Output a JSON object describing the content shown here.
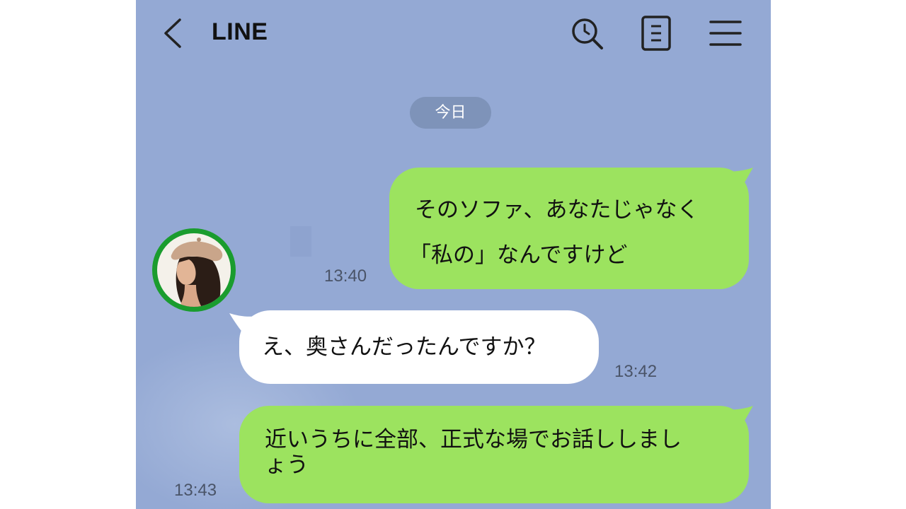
{
  "header": {
    "title": "LINE",
    "icons": [
      "back-icon",
      "search-icon",
      "notes-icon",
      "menu-icon"
    ]
  },
  "date_label": "今日",
  "messages": [
    {
      "side": "sent",
      "lines": [
        "そのソファ、あなたじゃなく",
        "「私の」なんですけど"
      ],
      "time": "13:40"
    },
    {
      "side": "received",
      "lines": [
        "え、奥さんだったんですか？"
      ],
      "time": "13:42"
    },
    {
      "side": "sent",
      "lines": [
        "近いうちに全部、正式な場でお話ししまし",
        "ょう"
      ],
      "time": "13:43"
    }
  ],
  "colors": {
    "background": "#94a9d4",
    "sent_bubble": "#9ce35f",
    "received_bubble": "#ffffff",
    "date_pill": "#7e93b9",
    "avatar_ring": "#1a9c2e"
  }
}
